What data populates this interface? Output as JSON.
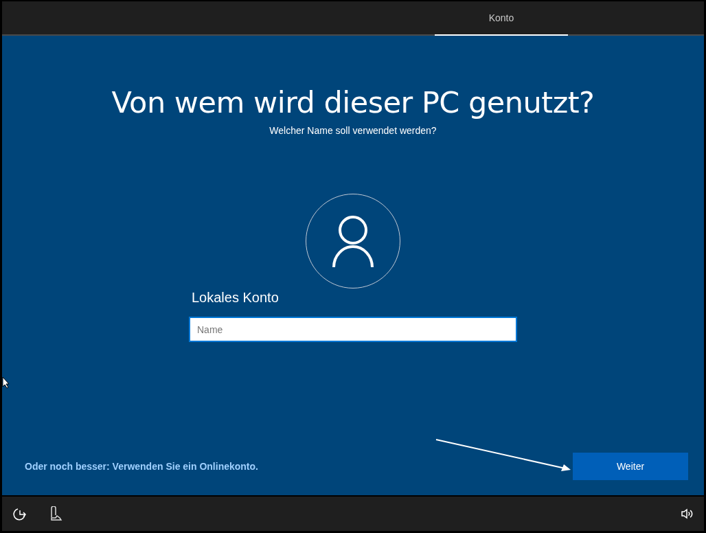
{
  "tabs": [
    {
      "label": "Konto",
      "selected": true
    }
  ],
  "heading": "Von wem wird dieser PC genutzt?",
  "subheading": "Welcher Name soll verwendet werden?",
  "account_section": {
    "label": "Lokales Konto",
    "name_field": {
      "placeholder": "Name"
    }
  },
  "online_account_link": "Oder noch besser: Verwenden Sie ein Onlinekonto.",
  "next_button": "Weiter"
}
